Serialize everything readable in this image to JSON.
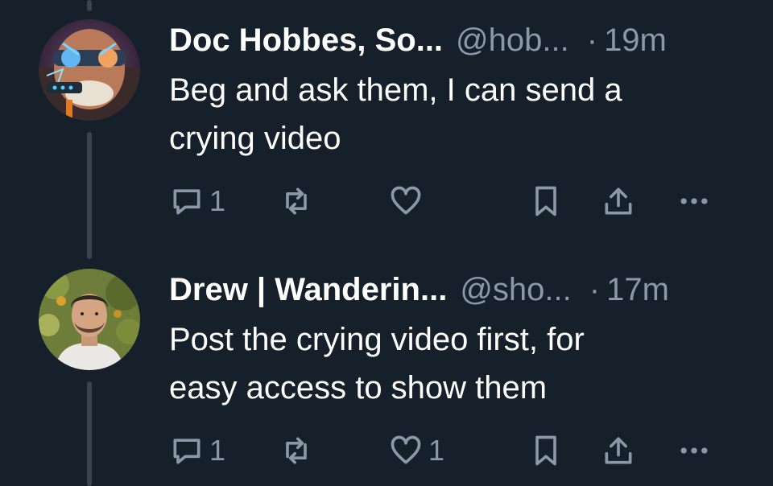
{
  "replies": [
    {
      "display_name": "Doc Hobbes, So...",
      "handle": "@hob...",
      "separator": "·",
      "time": "19m",
      "text_line1": "Beg and ask them, I can send a",
      "text_line2": "crying video",
      "reply_count": "1",
      "retweet_count": "",
      "like_count": ""
    },
    {
      "display_name": "Drew | Wanderin...",
      "handle": "@sho...",
      "separator": "·",
      "time": "17m",
      "text_line1": "Post the crying video first, for",
      "text_line2": "easy access to show them",
      "reply_count": "1",
      "retweet_count": "",
      "like_count": "1"
    }
  ],
  "icons": {
    "reply": "speech-bubble-icon",
    "retweet": "retweet-icon",
    "like": "heart-icon",
    "bookmark": "bookmark-icon",
    "share": "share-icon",
    "more": "more-icon"
  },
  "colors": {
    "background": "#15202b",
    "text_primary": "#ffffff",
    "text_secondary": "#8b98a5",
    "thread_line": "#38444d"
  }
}
